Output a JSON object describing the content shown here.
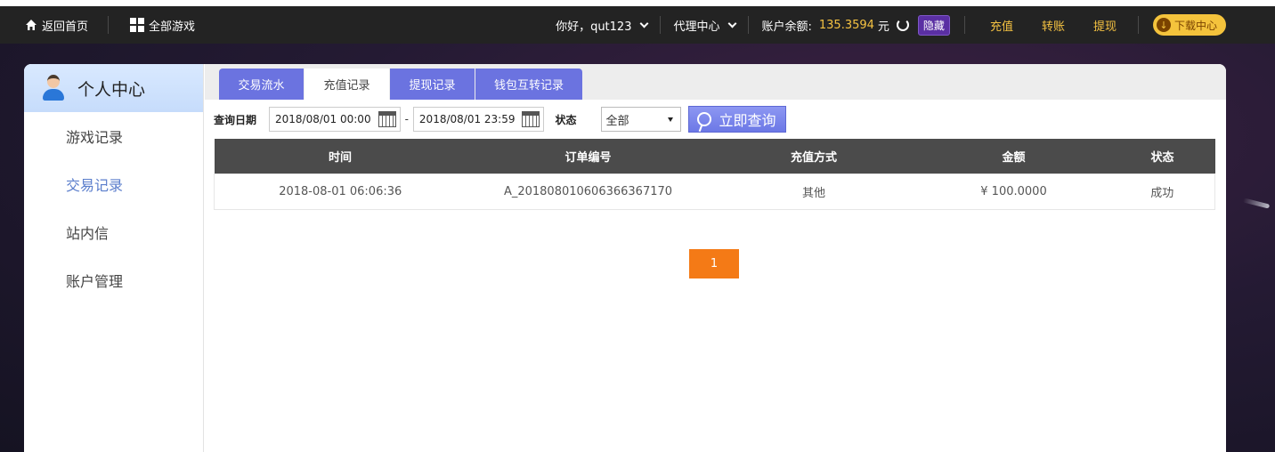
{
  "topbar": {
    "home": "返回首页",
    "all_games": "全部游戏",
    "greeting": "你好，qut123",
    "agent_center": "代理中心",
    "balance_label": "账户余额:",
    "balance_value": "135.3594",
    "balance_unit": "元",
    "hide": "隐藏",
    "recharge": "充值",
    "transfer": "转账",
    "withdraw": "提现",
    "download": "下载中心"
  },
  "sidebar": {
    "title": "个人中心",
    "items": [
      {
        "label": "游戏记录",
        "active": false
      },
      {
        "label": "交易记录",
        "active": true
      },
      {
        "label": "站内信",
        "active": false
      },
      {
        "label": "账户管理",
        "active": false
      }
    ]
  },
  "tabs": [
    {
      "label": "交易流水",
      "active": false
    },
    {
      "label": "充值记录",
      "active": true
    },
    {
      "label": "提现记录",
      "active": false
    },
    {
      "label": "钱包互转记录",
      "active": false
    }
  ],
  "filter": {
    "date_label": "查询日期",
    "start_date": "2018/08/01 00:00",
    "end_date": "2018/08/01 23:59",
    "status_label": "状态",
    "status_value": "全部",
    "query_button": "立即查询"
  },
  "table": {
    "headers": [
      "时间",
      "订单编号",
      "充值方式",
      "金额",
      "状态"
    ],
    "rows": [
      [
        "2018-08-01 06:06:36",
        "A_201808010606366367170",
        "其他",
        "¥ 100.0000",
        "成功"
      ]
    ]
  },
  "pagination": {
    "current": "1"
  },
  "colors": {
    "accent": "#6b73e0",
    "gold": "#f6c342",
    "pager": "#f47a16",
    "active_side": "#5b7ecc"
  }
}
